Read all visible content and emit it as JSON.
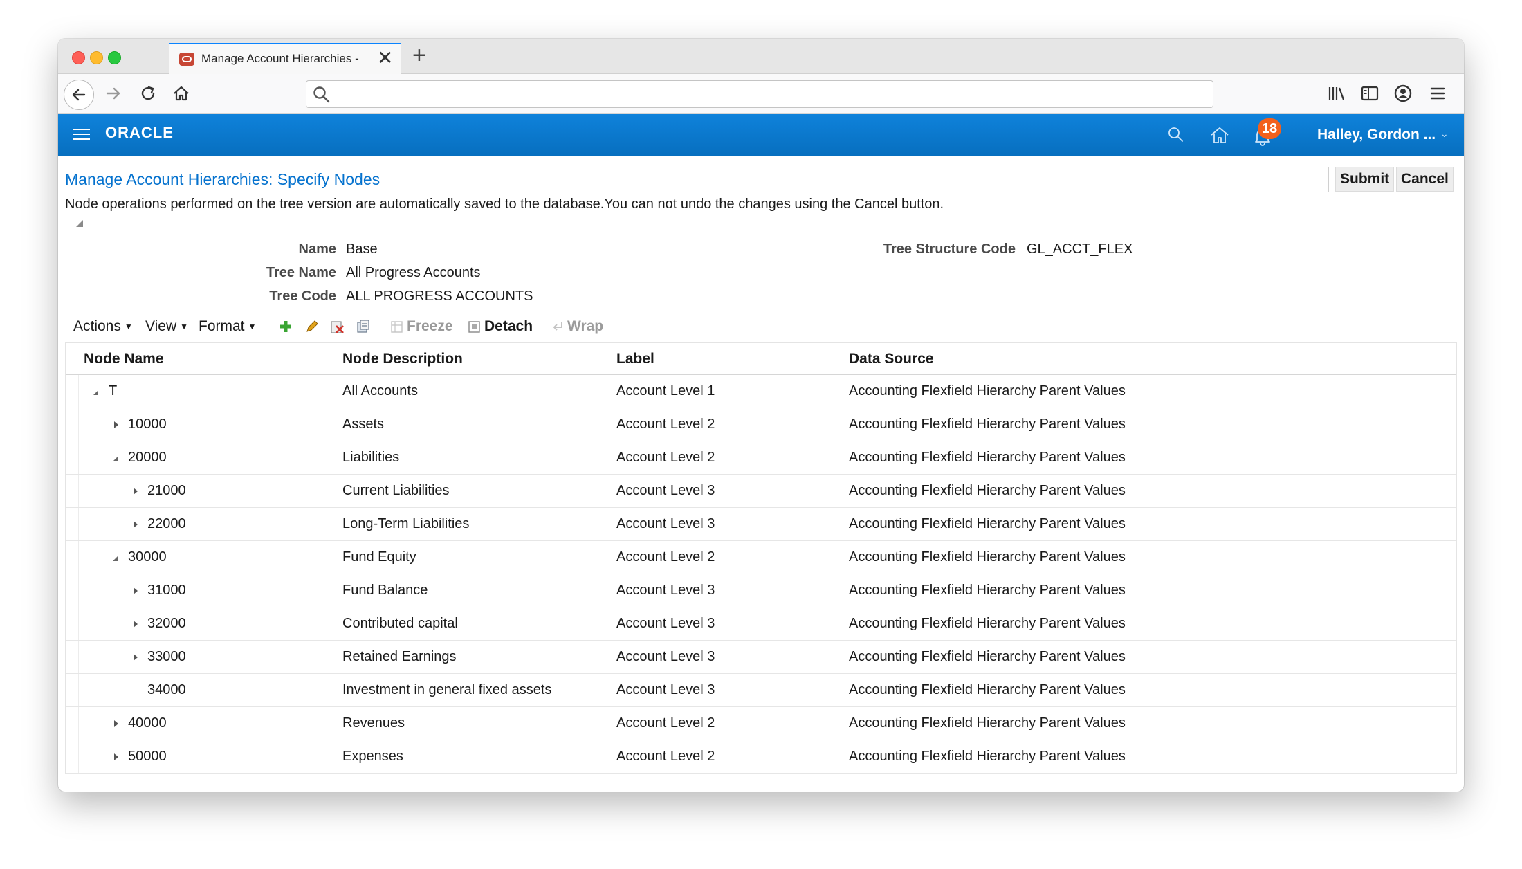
{
  "browser": {
    "tab_title": "Manage Account Hierarchies - S",
    "tab_close": "✕",
    "new_tab": "+"
  },
  "header": {
    "logo": "ORACLE",
    "notification_count": "18",
    "user": "Halley, Gordon ...",
    "user_chevron": "⌄"
  },
  "page": {
    "title": "Manage Account Hierarchies: Specify Nodes",
    "notice": "Node operations performed on the tree version are automatically saved to the database.You can not undo the changes using the Cancel button.",
    "submit_label": "Submit",
    "cancel_label": "Cancel"
  },
  "fields": {
    "name_label": "Name",
    "name_value": "Base",
    "tree_name_label": "Tree Name",
    "tree_name_value": "All Progress Accounts",
    "tree_code_label": "Tree Code",
    "tree_code_value": "ALL PROGRESS ACCOUNTS",
    "structure_code_label": "Tree Structure Code",
    "structure_code_value": "GL_ACCT_FLEX"
  },
  "toolbar": {
    "actions": "Actions",
    "view": "View",
    "format": "Format",
    "freeze": "Freeze",
    "detach": "Detach",
    "wrap": "Wrap"
  },
  "table": {
    "columns": [
      "Node Name",
      "Node Description",
      "Label",
      "Data Source"
    ],
    "rows": [
      {
        "name": "T",
        "desc": "All Accounts",
        "label": "Account Level 1",
        "source": "Accounting Flexfield Hierarchy Parent Values",
        "level": 0,
        "state": "expanded"
      },
      {
        "name": "10000",
        "desc": "Assets",
        "label": "Account Level 2",
        "source": "Accounting Flexfield Hierarchy Parent Values",
        "level": 1,
        "state": "collapsed"
      },
      {
        "name": "20000",
        "desc": "Liabilities",
        "label": "Account Level 2",
        "source": "Accounting Flexfield Hierarchy Parent Values",
        "level": 1,
        "state": "expanded"
      },
      {
        "name": "21000",
        "desc": "Current Liabilities",
        "label": "Account Level 3",
        "source": "Accounting Flexfield Hierarchy Parent Values",
        "level": 2,
        "state": "collapsed"
      },
      {
        "name": "22000",
        "desc": "Long-Term Liabilities",
        "label": "Account Level 3",
        "source": "Accounting Flexfield Hierarchy Parent Values",
        "level": 2,
        "state": "collapsed"
      },
      {
        "name": "30000",
        "desc": "Fund Equity",
        "label": "Account Level 2",
        "source": "Accounting Flexfield Hierarchy Parent Values",
        "level": 1,
        "state": "expanded"
      },
      {
        "name": "31000",
        "desc": "Fund Balance",
        "label": "Account Level 3",
        "source": "Accounting Flexfield Hierarchy Parent Values",
        "level": 2,
        "state": "collapsed"
      },
      {
        "name": "32000",
        "desc": "Contributed capital",
        "label": "Account Level 3",
        "source": "Accounting Flexfield Hierarchy Parent Values",
        "level": 2,
        "state": "collapsed"
      },
      {
        "name": "33000",
        "desc": "Retained Earnings",
        "label": "Account Level 3",
        "source": "Accounting Flexfield Hierarchy Parent Values",
        "level": 2,
        "state": "collapsed"
      },
      {
        "name": "34000",
        "desc": "Investment in general fixed assets",
        "label": "Account Level 3",
        "source": "Accounting Flexfield Hierarchy Parent Values",
        "level": 2,
        "state": "leaf"
      },
      {
        "name": "40000",
        "desc": "Revenues",
        "label": "Account Level 2",
        "source": "Accounting Flexfield Hierarchy Parent Values",
        "level": 1,
        "state": "collapsed"
      },
      {
        "name": "50000",
        "desc": "Expenses",
        "label": "Account Level 2",
        "source": "Accounting Flexfield Hierarchy Parent Values",
        "level": 1,
        "state": "collapsed"
      }
    ]
  },
  "icons": {
    "back": "arrow-left-icon",
    "forward": "arrow-right-icon",
    "reload": "reload-icon",
    "home": "home-icon",
    "search": "search-icon",
    "library": "library-icon",
    "sidebar": "sidebar-icon",
    "account": "account-icon",
    "menu": "menu-icon",
    "add": "add-icon",
    "edit": "pencil-icon",
    "delete": "delete-icon",
    "export": "export-icon",
    "bell": "bell-icon"
  },
  "colors": {
    "oracle_blue": "#0b7ad1",
    "title_link": "#0572ce",
    "badge": "#f2611d",
    "add_green": "#3aa533"
  }
}
